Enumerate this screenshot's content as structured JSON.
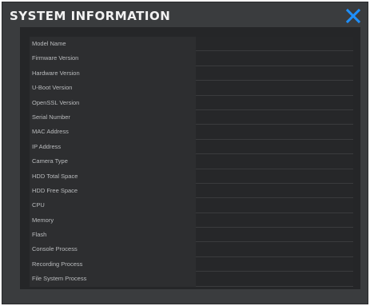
{
  "dialog": {
    "title": "SYSTEM INFORMATION",
    "close_icon": "close-icon",
    "accent_color": "#1e90ff"
  },
  "info": {
    "rows": [
      {
        "label": "Model Name",
        "value": ""
      },
      {
        "label": "Firmware Version",
        "value": ""
      },
      {
        "label": "Hardware Version",
        "value": ""
      },
      {
        "label": "U-Boot Version",
        "value": ""
      },
      {
        "label": "OpenSSL Version",
        "value": ""
      },
      {
        "label": "Serial Number",
        "value": ""
      },
      {
        "label": "MAC Address",
        "value": ""
      },
      {
        "label": "IP Address",
        "value": ""
      },
      {
        "label": "Camera Type",
        "value": ""
      },
      {
        "label": "HDD Total Space",
        "value": ""
      },
      {
        "label": "HDD Free Space",
        "value": ""
      },
      {
        "label": "CPU",
        "value": ""
      },
      {
        "label": "Memory",
        "value": ""
      },
      {
        "label": "Flash",
        "value": ""
      },
      {
        "label": "Console Process",
        "value": ""
      },
      {
        "label": "Recording Process",
        "value": ""
      },
      {
        "label": "File System Process",
        "value": ""
      }
    ]
  }
}
